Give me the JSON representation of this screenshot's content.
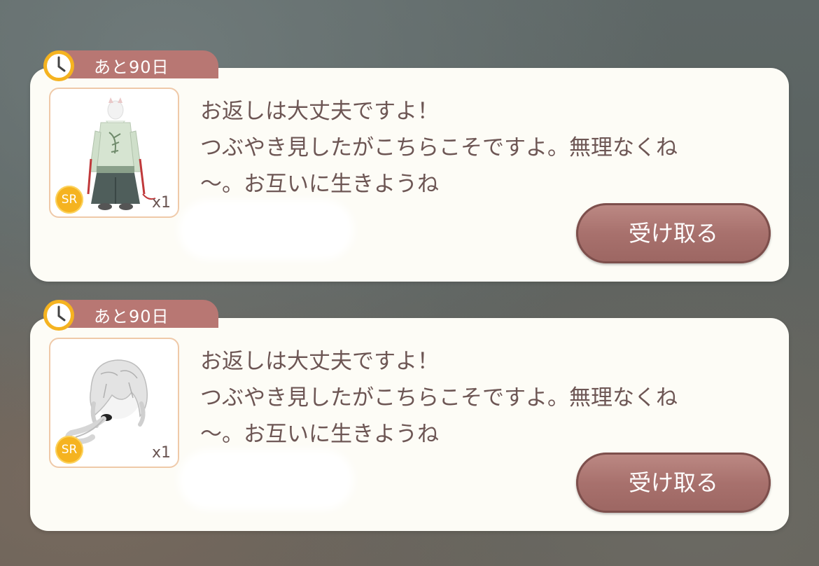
{
  "colors": {
    "card_background": "#fdfcf6",
    "timer_tab": "#b87773",
    "clock_ring": "#f5b320",
    "rarity_badge": "#f5b320",
    "button": "#a8716d",
    "text": "#6d5654",
    "item_frame_border": "#efc9a8"
  },
  "gifts": [
    {
      "timer_label": "あと90日",
      "timer_icon": "clock-icon",
      "item": {
        "name": "outfit-item",
        "rarity": "SR",
        "quantity": "x1"
      },
      "message_lines": [
        "お返しは大丈夫ですよ！",
        "つぶやき見したがこちらこそですよ。無理なくね",
        "〜。お互いに生きようね"
      ],
      "button_label": "受け取る"
    },
    {
      "timer_label": "あと90日",
      "timer_icon": "clock-icon",
      "item": {
        "name": "hair-item",
        "rarity": "SR",
        "quantity": "x1"
      },
      "message_lines": [
        "お返しは大丈夫ですよ！",
        "つぶやき見したがこちらこそですよ。無理なくね",
        "〜。お互いに生きようね"
      ],
      "button_label": "受け取る"
    }
  ]
}
